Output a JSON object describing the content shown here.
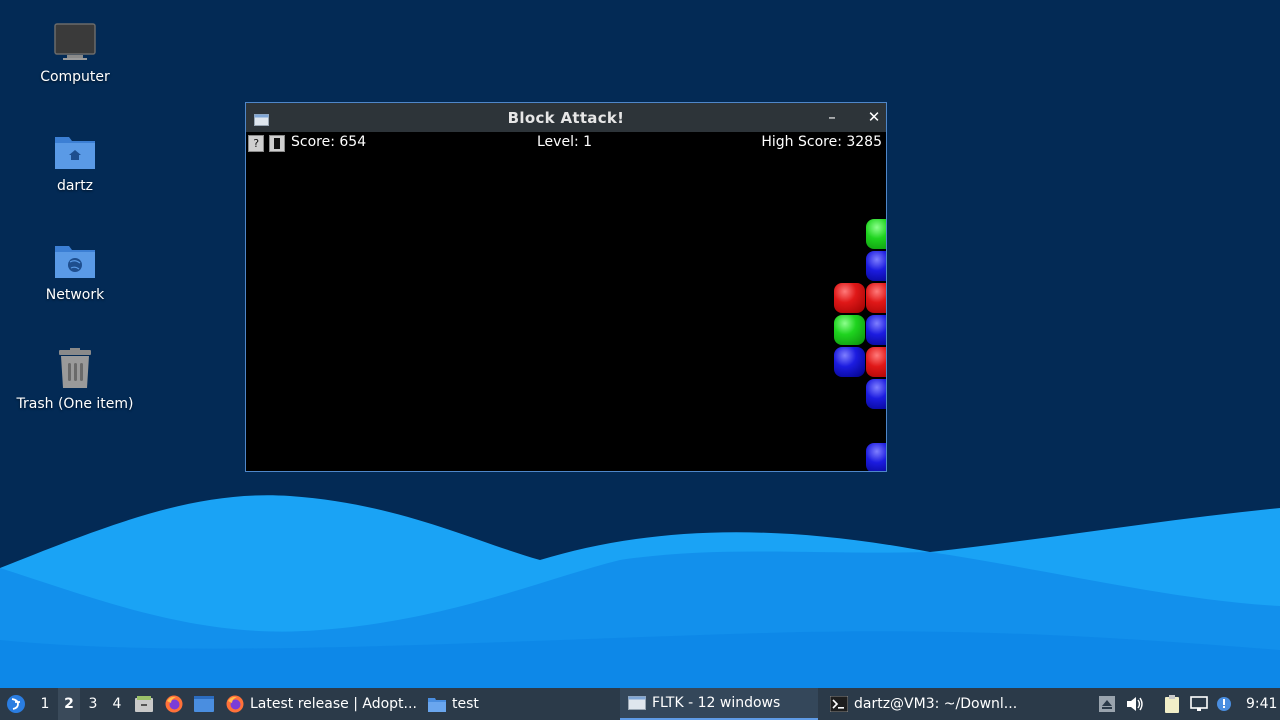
{
  "desktop": {
    "icons": [
      {
        "label": "Computer",
        "icon": "computer-icon"
      },
      {
        "label": "dartz",
        "icon": "home-folder-icon"
      },
      {
        "label": "Network",
        "icon": "network-folder-icon"
      },
      {
        "label": "Trash (One item)",
        "icon": "trash-icon"
      }
    ]
  },
  "window": {
    "title": "Block Attack!",
    "minimize_symbol": "–",
    "close_symbol": "✕",
    "hud": {
      "help_symbol": "?",
      "score": "Score: 654",
      "level": "Level: 1",
      "high_score": "High Score: 3285"
    },
    "blocks": [
      {
        "color": "green",
        "col": 1,
        "row": 0
      },
      {
        "color": "blue",
        "col": 1,
        "row": 1
      },
      {
        "color": "red",
        "col": 0,
        "row": 2
      },
      {
        "color": "red",
        "col": 1,
        "row": 2
      },
      {
        "color": "green",
        "col": 0,
        "row": 3
      },
      {
        "color": "blue",
        "col": 1,
        "row": 3
      },
      {
        "color": "blue",
        "col": 0,
        "row": 4
      },
      {
        "color": "red",
        "col": 1,
        "row": 4
      },
      {
        "color": "blue",
        "col": 1,
        "row": 5
      },
      {
        "color": "blue",
        "col": 1,
        "row": 7
      }
    ]
  },
  "taskbar": {
    "workspaces": [
      "1",
      "2",
      "3",
      "4"
    ],
    "active_workspace": "2",
    "tasks": [
      {
        "label": "Latest release | Adopt...",
        "icon": "firefox-icon"
      },
      {
        "label": "test",
        "icon": "folder-icon"
      },
      {
        "label": "FLTK - 12 windows",
        "icon": "window-icon"
      },
      {
        "label": "dartz@VM3: ~/Downl...",
        "icon": "terminal-icon"
      }
    ],
    "clock": "9:41"
  },
  "colors": {
    "desktop_bg": "#032a55",
    "wave_light": "#1aa3f5",
    "wave_mid": "#0d7fe0",
    "taskbar_bg": "#2b3a49",
    "titlebar_bg": "#2d3439",
    "window_border": "#4f87c9"
  }
}
